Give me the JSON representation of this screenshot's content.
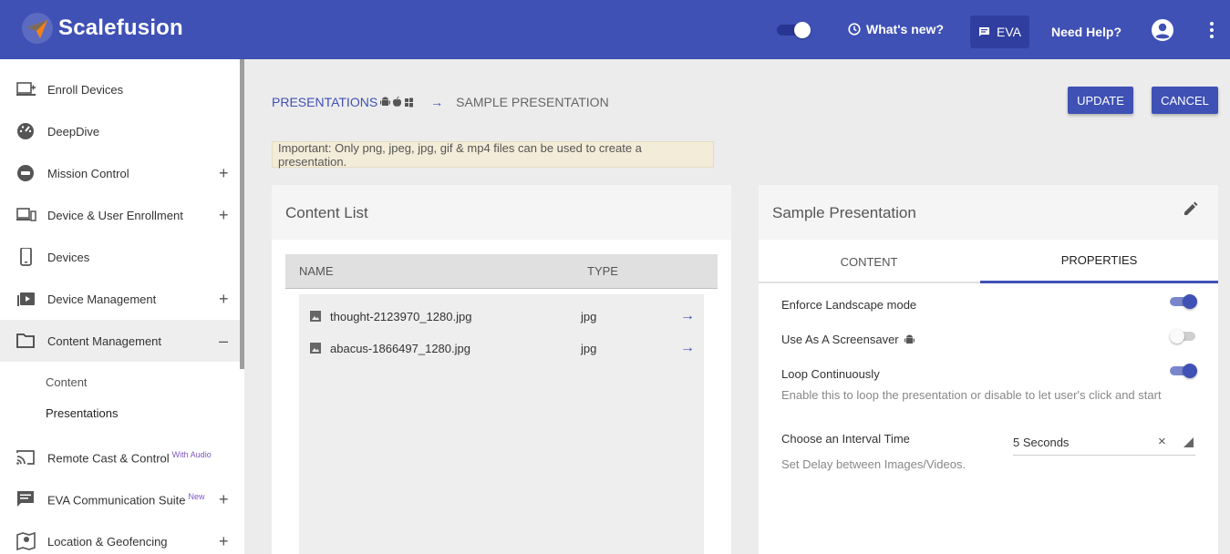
{
  "header": {
    "brand": "Scalefusion",
    "whats_new": "What's new?",
    "eva": "EVA",
    "need_help": "Need Help?"
  },
  "sidebar": {
    "items": [
      {
        "label": "Enroll Devices",
        "icon": "enroll-devices-icon"
      },
      {
        "label": "DeepDive",
        "icon": "dashboard-gauge-icon"
      },
      {
        "label": "Mission Control",
        "icon": "mission-control-icon",
        "expand": "+"
      },
      {
        "label": "Device & User Enrollment",
        "icon": "devices-icon",
        "expand": "+"
      },
      {
        "label": "Devices",
        "icon": "phone-icon"
      },
      {
        "label": "Device Management",
        "icon": "device-management-icon",
        "expand": "+"
      },
      {
        "label": "Content Management",
        "icon": "folder-icon",
        "expand": "–"
      },
      {
        "label": "Remote Cast & Control",
        "badge": "With Audio",
        "icon": "cast-icon"
      },
      {
        "label": "EVA Communication Suite",
        "badge": "New",
        "icon": "chat-icon",
        "expand": "+"
      },
      {
        "label": "Location & Geofencing",
        "icon": "location-icon",
        "expand": "+"
      }
    ],
    "sub_items": [
      "Content",
      "Presentations"
    ]
  },
  "breadcrumb": {
    "parent": "PRESENTATIONS",
    "arrow": "→",
    "current": "SAMPLE PRESENTATION"
  },
  "actions": {
    "update": "UPDATE",
    "cancel": "CANCEL"
  },
  "notice": "Important: Only png, jpeg, jpg, gif & mp4 files can be used to create a presentation.",
  "content_list": {
    "title": "Content List",
    "columns": [
      "NAME",
      "TYPE"
    ],
    "rows": [
      {
        "name": "thought-2123970_1280.jpg",
        "type": "jpg",
        "action": "→"
      },
      {
        "name": "abacus-1866497_1280.jpg",
        "type": "jpg",
        "action": "→"
      }
    ]
  },
  "presentation": {
    "title": "Sample Presentation",
    "tabs": [
      "CONTENT",
      "PROPERTIES"
    ],
    "active_tab": "PROPERTIES",
    "properties": {
      "landscape": {
        "label": "Enforce Landscape mode",
        "on": true
      },
      "screensaver": {
        "label": "Use As A Screensaver",
        "on": false
      },
      "loop": {
        "label": "Loop Continuously",
        "on": true,
        "desc": "Enable this to loop the presentation or disable to let user's click and start"
      },
      "interval": {
        "label": "Choose an Interval Time",
        "desc": "Set Delay between Images/Videos.",
        "value": "5 Seconds",
        "clear": "×"
      }
    }
  },
  "colors": {
    "primary": "#3f51b5",
    "primary_dark": "#303f9f",
    "badge": "#7e57c2",
    "notice_bg": "#f3ecd8"
  }
}
